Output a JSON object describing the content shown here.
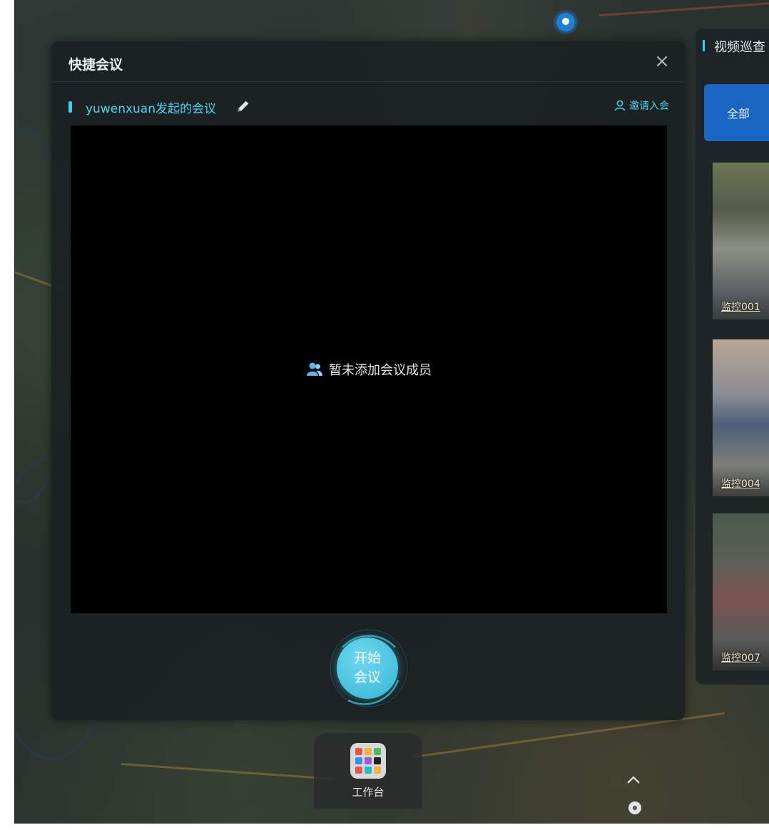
{
  "dialog": {
    "title": "快捷会议",
    "close_icon": "close-icon",
    "meeting_name": "yuwenxuan发起的会议",
    "edit_icon": "pencil-icon",
    "invite_label": "邀请入会",
    "invite_icon": "user-icon",
    "empty_icon": "users-icon",
    "empty_text": "暂未添加会议成员",
    "start_label_line1": "开始",
    "start_label_line2": "会议"
  },
  "right_panel": {
    "title": "视频巡查",
    "tab_all": "全部",
    "thumbnails": [
      {
        "label": "监控001"
      },
      {
        "label": "监控004"
      },
      {
        "label": "监控007"
      }
    ]
  },
  "dock": {
    "label": "工作台",
    "icon": "grid-apps-icon"
  },
  "colors": {
    "accent": "#4fd3f5",
    "start_button": "#33b6d6",
    "tab_active": "#1866c2",
    "dialog_bg": "#1c2122"
  }
}
